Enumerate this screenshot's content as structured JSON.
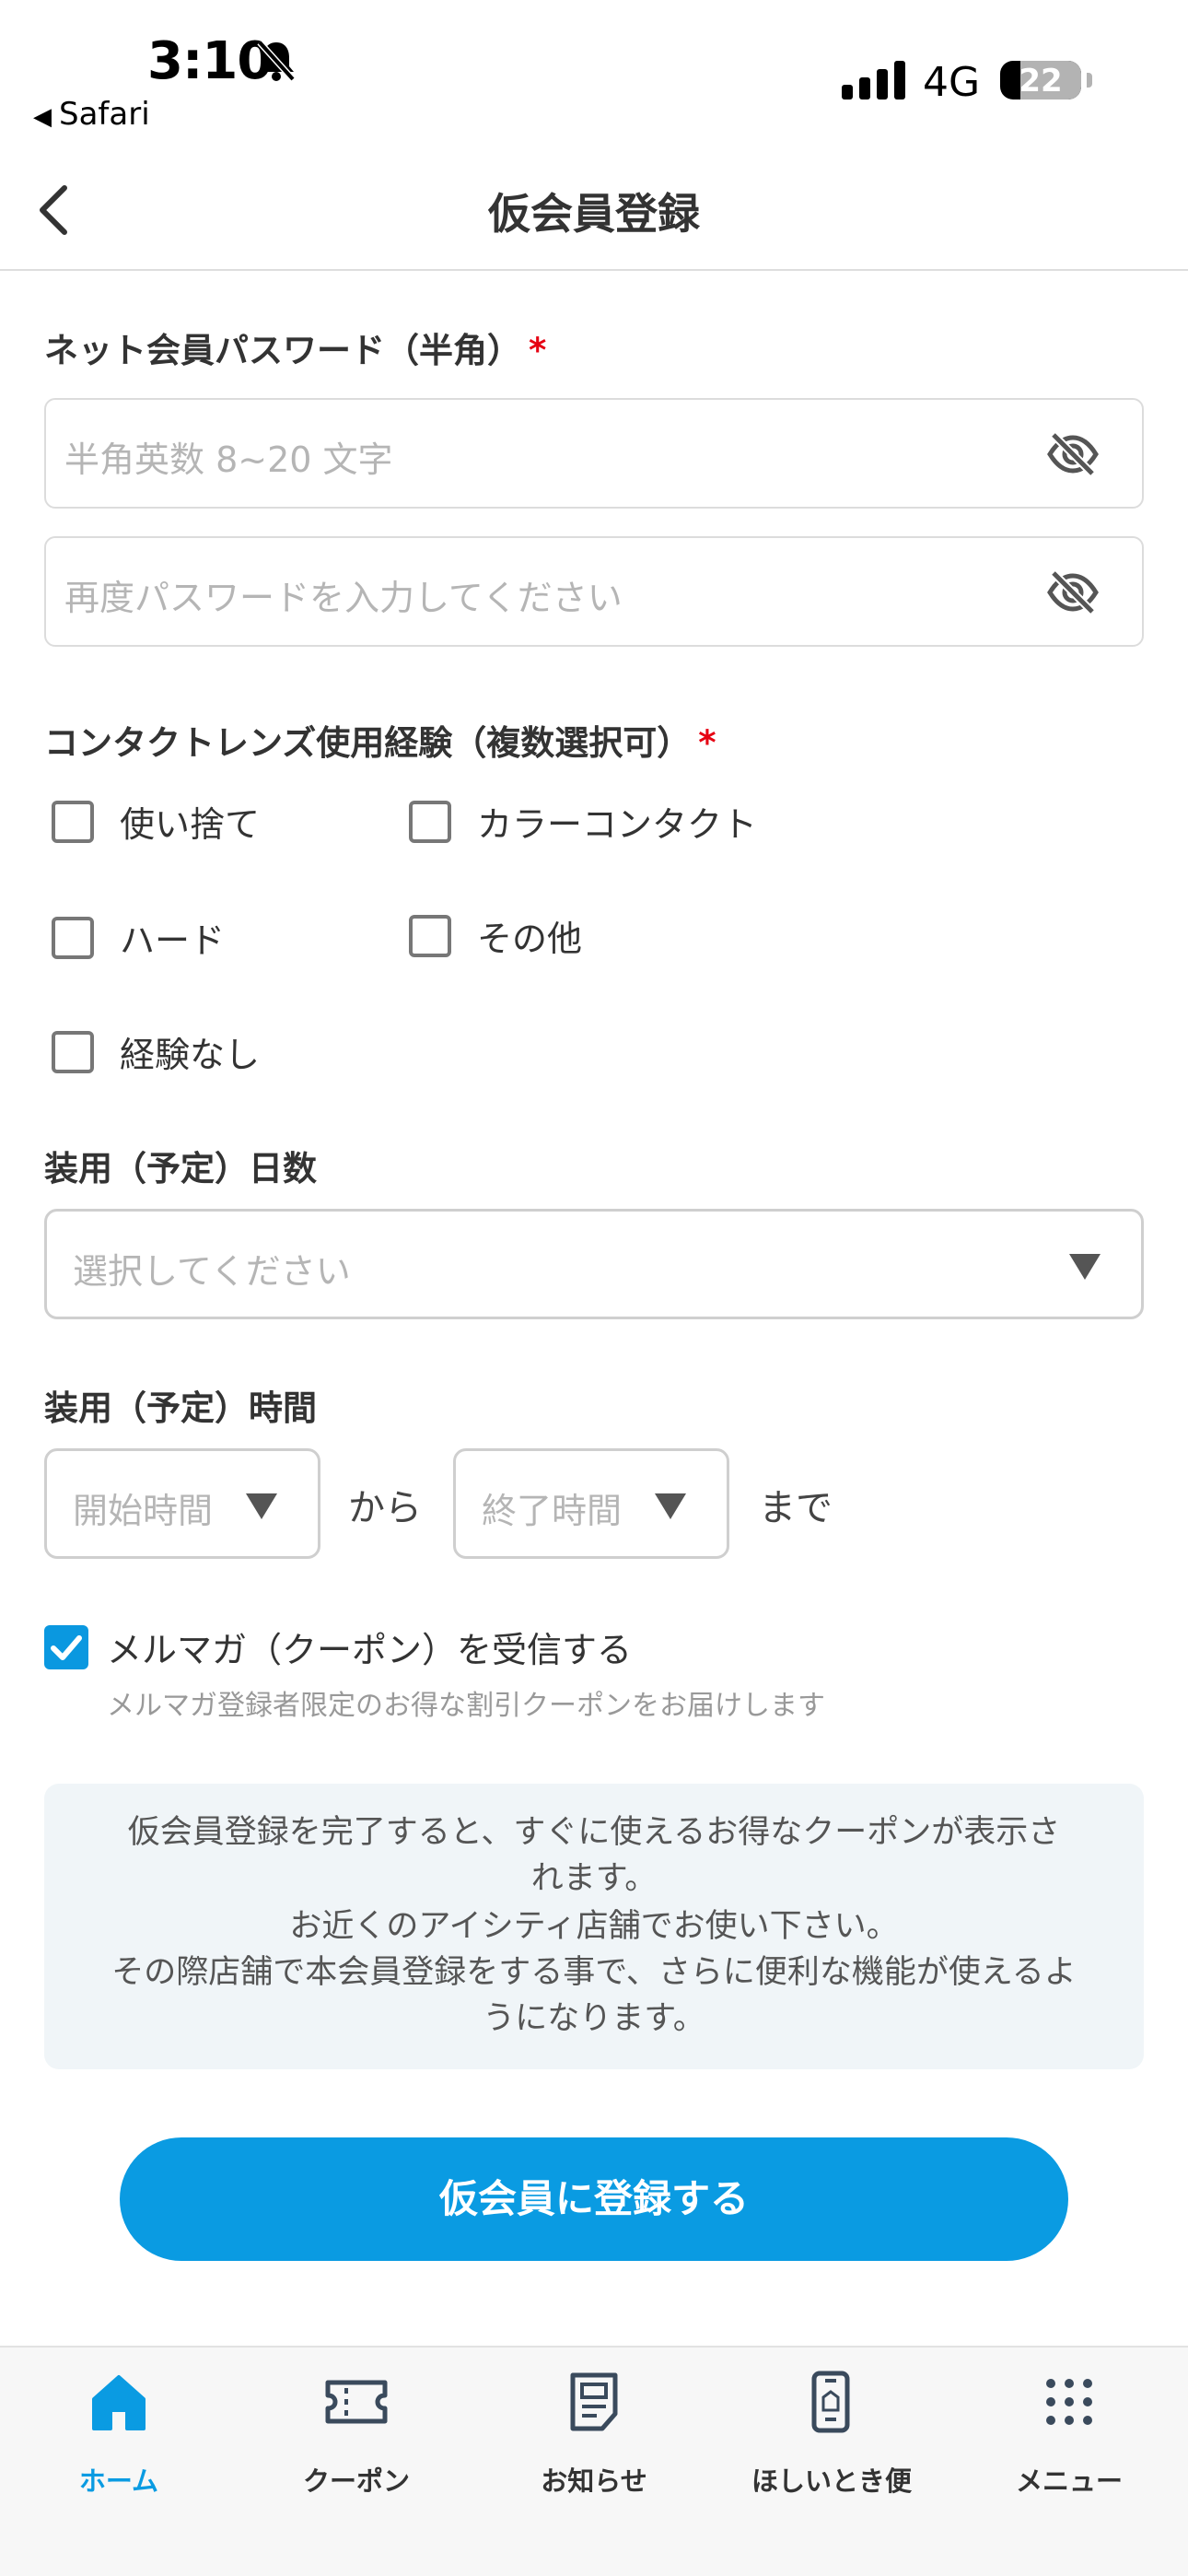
{
  "status_bar": {
    "time": "3:10",
    "back_app": "Safari",
    "network": "4G",
    "battery": "22"
  },
  "header": {
    "title": "仮会員登録"
  },
  "password_section": {
    "label": "ネット会員パスワード（半角）",
    "required_mark": "*",
    "password_placeholder": "半角英数 8~20 文字",
    "confirm_placeholder": "再度パスワードを入力してください"
  },
  "contact_section": {
    "label": "コンタクトレンズ使用経験（複数選択可）",
    "required_mark": "*",
    "options": [
      "使い捨て",
      "カラーコンタクト",
      "ハード",
      "その他",
      "経験なし"
    ]
  },
  "wear_days": {
    "label": "装用（予定）日数",
    "placeholder": "選択してください"
  },
  "wear_time": {
    "label": "装用（予定）時間",
    "start_placeholder": "開始時間",
    "from_text": "から",
    "end_placeholder": "終了時間",
    "until_text": "まで"
  },
  "newsletter": {
    "label": "メルマガ（クーポン）を受信する",
    "description": "メルマガ登録者限定のお得な割引クーポンをお届けします",
    "checked": true
  },
  "info": {
    "lines": [
      "仮会員登録を完了すると、すぐに使えるお得なクーポンが表示さ",
      "れます。",
      "お近くのアイシティ店舗でお使い下さい。",
      "その際店舗で本会員登録をする事で、さらに便利な機能が使えるよ",
      "うになります。"
    ]
  },
  "submit_button": "仮会員に登録する",
  "tabbar": {
    "items": [
      {
        "label": "ホーム",
        "icon": "home-icon",
        "active": true
      },
      {
        "label": "クーポン",
        "icon": "ticket-icon",
        "active": false
      },
      {
        "label": "お知らせ",
        "icon": "notice-icon",
        "active": false
      },
      {
        "label": "ほしいとき便",
        "icon": "phone-delivery-icon",
        "active": false
      },
      {
        "label": "メニュー",
        "icon": "grid-menu-icon",
        "active": false
      }
    ]
  },
  "colors": {
    "accent": "#0a9be2",
    "required": "#e60012",
    "info_bg": "#f0f5f8"
  }
}
